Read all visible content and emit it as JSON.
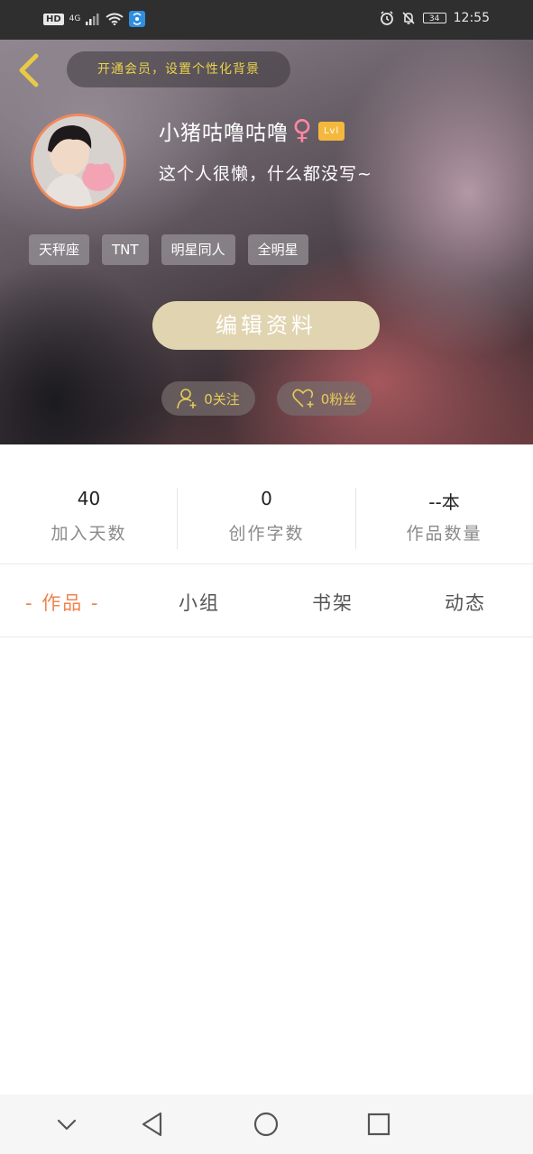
{
  "status_bar": {
    "hd": "HD",
    "network": "4G",
    "battery": "34",
    "time": "12:55"
  },
  "header": {
    "vip_text": "开通会员，设置个性化背景"
  },
  "profile": {
    "username": "小猪咕噜咕噜",
    "gender_symbol": "♀",
    "level": "Lvl",
    "bio": "这个人很懒，什么都没写~",
    "tags": [
      "天秤座",
      "TNT",
      "明星同人",
      "全明星"
    ],
    "edit_button": "编辑资料",
    "following": "0关注",
    "followers": "0粉丝"
  },
  "stats": [
    {
      "value": "40",
      "label": "加入天数"
    },
    {
      "value": "0",
      "label": "创作字数"
    },
    {
      "value": "--本",
      "label": "作品数量"
    }
  ],
  "tabs": [
    {
      "label": "- 作品 -",
      "active": true
    },
    {
      "label": "小组",
      "active": false
    },
    {
      "label": "书架",
      "active": false
    },
    {
      "label": "动态",
      "active": false
    }
  ],
  "colors": {
    "accent": "#f0834f",
    "vip_text": "#e9d24a",
    "edit_button": "#e1d4b1",
    "level_badge": "#f4b93c",
    "female": "#ff86a4"
  }
}
